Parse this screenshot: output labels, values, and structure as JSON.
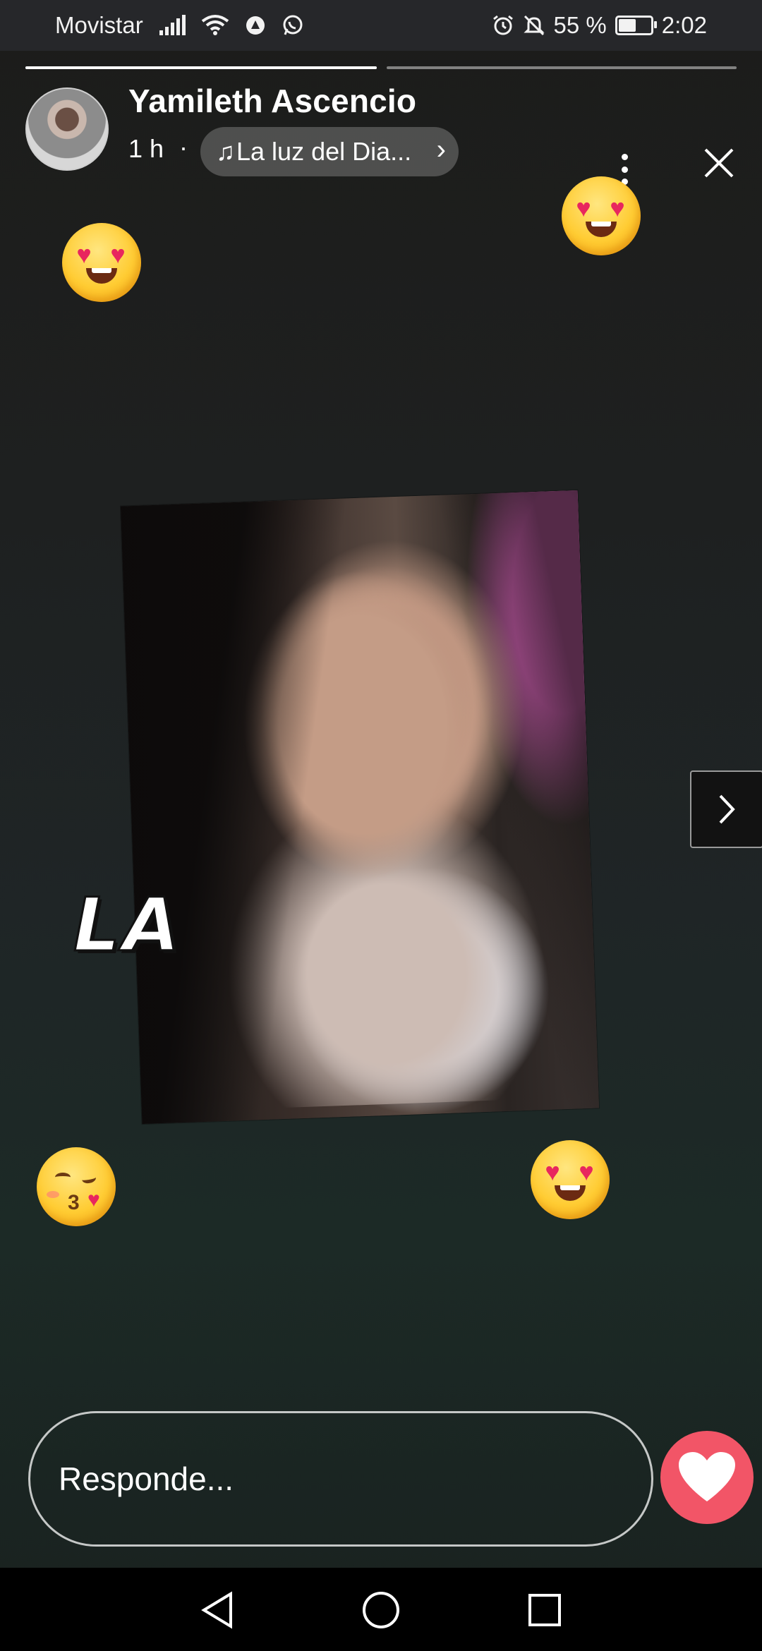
{
  "status_bar": {
    "carrier": "Movistar",
    "battery_percent": "55 %",
    "time": "2:02",
    "icons": [
      "signal-icon",
      "wifi-icon",
      "data-saver-icon",
      "whatsapp-icon",
      "alarm-icon",
      "mute-icon",
      "battery-icon"
    ]
  },
  "story": {
    "progress": [
      1.0,
      0.0
    ],
    "username": "Yamileth Ascencio",
    "posted_ago": "1 h",
    "separator": "·",
    "music_title": "La luz del Dia...",
    "overlay_text": "LA"
  },
  "reply": {
    "placeholder": "Responde..."
  },
  "colors": {
    "like_button": "#f25567",
    "status_bar_bg": "#26272a",
    "nav_bar_bg": "#000000"
  }
}
